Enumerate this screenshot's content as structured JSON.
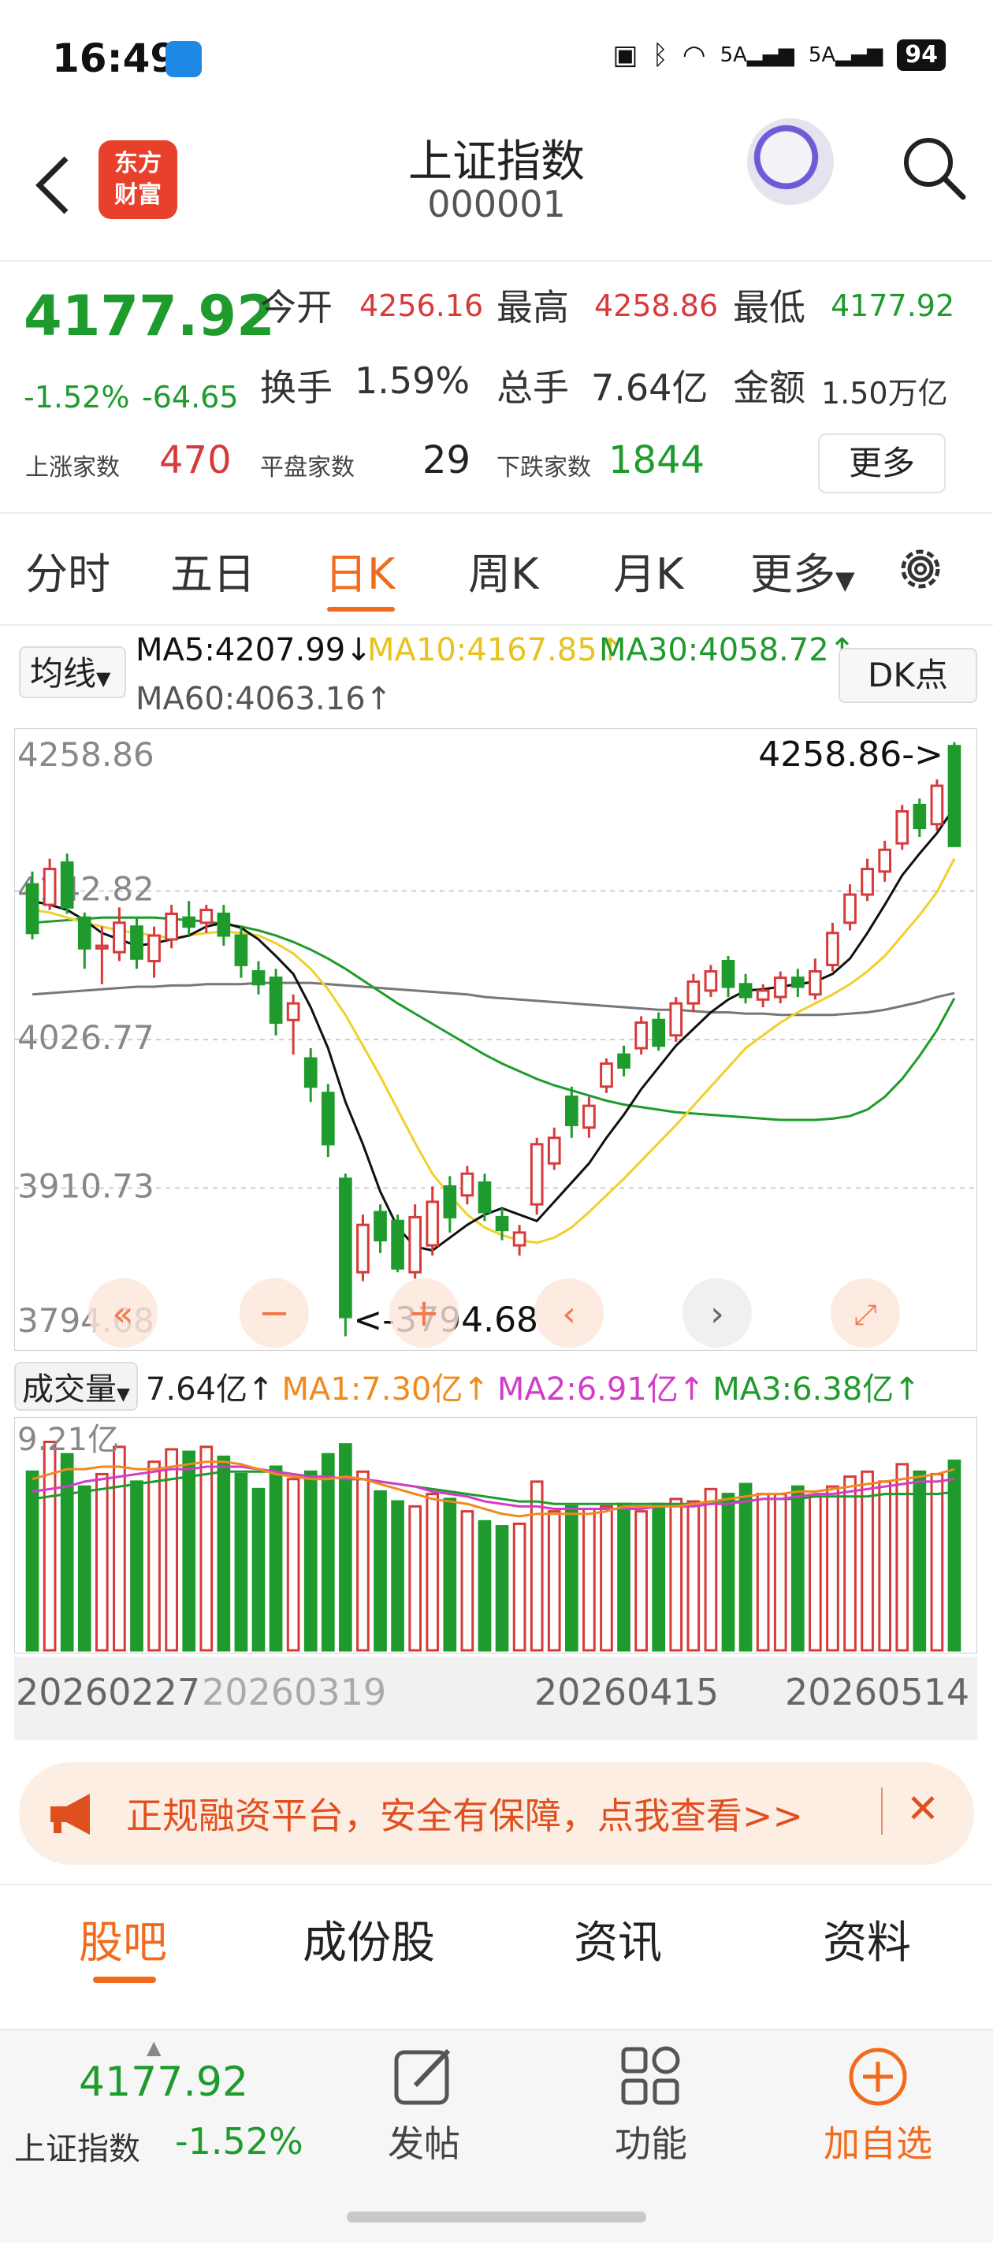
{
  "status_bar": {
    "time": "16:49",
    "battery": "94",
    "net1": "5A",
    "net2": "5A",
    "icons": [
      "nfc-icon",
      "bluetooth-icon",
      "wifi-icon",
      "signal-icon",
      "signal-icon",
      "battery-icon"
    ]
  },
  "header": {
    "logo_line1": "东方",
    "logo_line2": "财富",
    "title": "上证指数",
    "code": "000001"
  },
  "quote": {
    "price": "4177.92",
    "change_pct": "-1.52%",
    "change_abs": "-64.65",
    "open_label": "今开",
    "open": "4256.16",
    "high_label": "最高",
    "high": "4258.86",
    "low_label": "最低",
    "low": "4177.92",
    "turnover_label": "换手",
    "turnover": "1.59%",
    "volume_label": "总手",
    "volume": "7.64亿",
    "amount_label": "金额",
    "amount": "1.50万亿",
    "up_label": "上涨家数",
    "up": "470",
    "flat_label": "平盘家数",
    "flat": "29",
    "down_label": "下跌家数",
    "down": "1844",
    "more": "更多"
  },
  "tabs": [
    "分时",
    "五日",
    "日K",
    "周K",
    "月K",
    "更多"
  ],
  "active_tab": "日K",
  "ma_legend": {
    "type": "均线",
    "ma5": "MA5:4207.99",
    "ma10": "MA10:4167.85",
    "ma30": "MA30:4058.72",
    "ma60": "MA60:4063.16",
    "dk": "DK点"
  },
  "colors": {
    "up": "#d63a3a",
    "down": "#1e9b2c",
    "ma5": "#111111",
    "ma10": "#f2cf2a",
    "ma30": "#1e9b2c",
    "ma60": "#777777",
    "accent": "#f26b1d",
    "ma_mag": "#d23cc8"
  },
  "chart_data": {
    "type": "candlestick",
    "y_ticks": [
      "4258.86",
      "4142.82",
      "4026.77",
      "3910.73",
      "3794.68"
    ],
    "ylim": [
      3794.68,
      4258.86
    ],
    "max_label": "4258.86->",
    "min_label": "<-3794.68",
    "dates": [
      "20260227",
      "20260319",
      "20260415",
      "20260514"
    ],
    "candles": [
      [
        4148,
        4110,
        4158,
        4105
      ],
      [
        4132,
        4160,
        4168,
        4128
      ],
      [
        4165,
        4130,
        4172,
        4125
      ],
      [
        4122,
        4098,
        4126,
        4082
      ],
      [
        4098,
        4100,
        4115,
        4070
      ],
      [
        4095,
        4118,
        4130,
        4088
      ],
      [
        4115,
        4090,
        4122,
        4082
      ],
      [
        4088,
        4108,
        4115,
        4075
      ],
      [
        4105,
        4125,
        4132,
        4098
      ],
      [
        4122,
        4115,
        4135,
        4108
      ],
      [
        4118,
        4128,
        4132,
        4110
      ],
      [
        4125,
        4108,
        4132,
        4100
      ],
      [
        4108,
        4085,
        4115,
        4075
      ],
      [
        4080,
        4070,
        4088,
        4062
      ],
      [
        4075,
        4040,
        4082,
        4030
      ],
      [
        4042,
        4055,
        4062,
        4015
      ],
      [
        4012,
        3990,
        4020,
        3978
      ],
      [
        3985,
        3945,
        3992,
        3935
      ],
      [
        3918,
        3810,
        3922,
        3795
      ],
      [
        3845,
        3882,
        3890,
        3838
      ],
      [
        3892,
        3870,
        3898,
        3860
      ],
      [
        3885,
        3848,
        3890,
        3845
      ],
      [
        3845,
        3888,
        3898,
        3840
      ],
      [
        3866,
        3900,
        3912,
        3858
      ],
      [
        3912,
        3888,
        3920,
        3876
      ],
      [
        3905,
        3922,
        3928,
        3898
      ],
      [
        3915,
        3892,
        3922,
        3885
      ],
      [
        3888,
        3878,
        3895,
        3870
      ],
      [
        3866,
        3876,
        3882,
        3858
      ],
      [
        3898,
        3945,
        3950,
        3890
      ],
      [
        3930,
        3950,
        3958,
        3925
      ],
      [
        3982,
        3960,
        3990,
        3950
      ],
      [
        3958,
        3975,
        3982,
        3950
      ],
      [
        3990,
        4008,
        4012,
        3985
      ],
      [
        4015,
        4005,
        4022,
        3998
      ],
      [
        4020,
        4040,
        4045,
        4015
      ],
      [
        4042,
        4022,
        4048,
        4018
      ],
      [
        4030,
        4055,
        4060,
        4025
      ],
      [
        4055,
        4072,
        4078,
        4048
      ],
      [
        4065,
        4080,
        4085,
        4060
      ],
      [
        4088,
        4068,
        4092,
        4060
      ],
      [
        4070,
        4060,
        4078,
        4055
      ],
      [
        4058,
        4065,
        4070,
        4052
      ],
      [
        4060,
        4075,
        4080,
        4055
      ],
      [
        4075,
        4068,
        4082,
        4060
      ],
      [
        4062,
        4080,
        4090,
        4058
      ],
      [
        4085,
        4110,
        4118,
        4080
      ],
      [
        4118,
        4140,
        4148,
        4112
      ],
      [
        4140,
        4160,
        4168,
        4135
      ],
      [
        4158,
        4175,
        4182,
        4150
      ],
      [
        4180,
        4205,
        4210,
        4175
      ],
      [
        4210,
        4192,
        4215,
        4185
      ],
      [
        4195,
        4225,
        4230,
        4190
      ],
      [
        4256,
        4178,
        4259,
        4177
      ]
    ],
    "ma5": [
      4135,
      4132,
      4128,
      4120,
      4110,
      4105,
      4100,
      4102,
      4105,
      4108,
      4115,
      4118,
      4114,
      4105,
      4092,
      4078,
      4052,
      4020,
      3978,
      3945,
      3908,
      3880,
      3865,
      3862,
      3872,
      3882,
      3890,
      3895,
      3890,
      3885,
      3900,
      3915,
      3930,
      3950,
      3968,
      3988,
      4005,
      4022,
      4035,
      4048,
      4058,
      4065,
      4066,
      4068,
      4070,
      4072,
      4078,
      4090,
      4110,
      4132,
      4155,
      4172,
      4188,
      4208
    ],
    "ma10": [
      4128,
      4126,
      4122,
      4118,
      4115,
      4112,
      4110,
      4108,
      4106,
      4108,
      4110,
      4111,
      4110,
      4108,
      4102,
      4094,
      4082,
      4066,
      4046,
      4022,
      3998,
      3972,
      3946,
      3922,
      3905,
      3890,
      3880,
      3874,
      3870,
      3868,
      3872,
      3880,
      3892,
      3905,
      3918,
      3932,
      3946,
      3960,
      3975,
      3990,
      4005,
      4020,
      4030,
      4040,
      4048,
      4055,
      4062,
      4070,
      4080,
      4092,
      4108,
      4124,
      4142,
      4168
    ],
    "ma30": [
      4118,
      4119,
      4120,
      4121,
      4122,
      4122,
      4122,
      4122,
      4121,
      4120,
      4119,
      4117,
      4115,
      4112,
      4108,
      4103,
      4097,
      4090,
      4082,
      4073,
      4064,
      4055,
      4047,
      4039,
      4031,
      4023,
      4015,
      4008,
      4002,
      3996,
      3991,
      3987,
      3983,
      3979,
      3976,
      3974,
      3972,
      3970,
      3969,
      3968,
      3967,
      3966,
      3965,
      3964,
      3964,
      3964,
      3965,
      3967,
      3972,
      3982,
      3996,
      4014,
      4034,
      4059
    ],
    "ma60": [
      4062,
      4063,
      4064,
      4065,
      4066,
      4067,
      4068,
      4068,
      4069,
      4069,
      4070,
      4070,
      4070,
      4071,
      4071,
      4071,
      4071,
      4070,
      4069,
      4068,
      4067,
      4066,
      4065,
      4064,
      4063,
      4062,
      4060,
      4059,
      4058,
      4057,
      4056,
      4055,
      4054,
      4053,
      4052,
      4051,
      4050,
      4050,
      4049,
      4048,
      4048,
      4047,
      4047,
      4046,
      4046,
      4046,
      4046,
      4047,
      4048,
      4050,
      4053,
      4056,
      4060,
      4063
    ]
  },
  "volume": {
    "label": "成交量",
    "current": "7.64亿",
    "ma1": "MA1:7.30亿",
    "ma2": "MA2:6.91亿",
    "ma3": "MA3:6.38亿",
    "max_label": "9.21亿",
    "ylim": [
      0,
      9.21
    ],
    "values": [
      7.2,
      8.4,
      7.9,
      6.6,
      7.1,
      8.2,
      6.8,
      7.6,
      8.1,
      8.0,
      8.2,
      7.8,
      7.1,
      6.5,
      7.4,
      6.9,
      7.2,
      7.9,
      8.3,
      7.2,
      6.4,
      6.0,
      5.8,
      6.3,
      6.1,
      5.6,
      5.2,
      5.0,
      5.1,
      6.8,
      5.6,
      5.8,
      5.7,
      5.8,
      5.9,
      5.6,
      5.9,
      6.1,
      6.0,
      6.5,
      6.3,
      6.7,
      6.3,
      6.3,
      6.6,
      6.2,
      6.6,
      7.0,
      7.2,
      6.8,
      7.5,
      7.2,
      7.1,
      7.64
    ],
    "ma1_series": [
      6.9,
      7.1,
      7.3,
      7.3,
      7.4,
      7.4,
      7.3,
      7.3,
      7.4,
      7.5,
      7.6,
      7.6,
      7.5,
      7.3,
      7.1,
      7.0,
      6.9,
      6.9,
      7.0,
      6.9,
      6.7,
      6.5,
      6.3,
      6.1,
      6.0,
      5.9,
      5.7,
      5.5,
      5.4,
      5.5,
      5.5,
      5.5,
      5.5,
      5.6,
      5.8,
      5.8,
      5.8,
      5.8,
      5.9,
      6.0,
      6.1,
      6.2,
      6.3,
      6.3,
      6.4,
      6.4,
      6.5,
      6.6,
      6.7,
      6.8,
      6.9,
      7.0,
      7.1,
      7.3
    ],
    "ma2_series": [
      6.4,
      6.5,
      6.6,
      6.8,
      6.9,
      7.0,
      7.1,
      7.2,
      7.3,
      7.3,
      7.4,
      7.4,
      7.4,
      7.3,
      7.2,
      7.1,
      7.0,
      7.0,
      6.9,
      6.9,
      6.8,
      6.7,
      6.6,
      6.4,
      6.3,
      6.2,
      6.0,
      5.9,
      5.8,
      5.8,
      5.7,
      5.7,
      5.7,
      5.7,
      5.7,
      5.7,
      5.8,
      5.8,
      5.8,
      5.9,
      5.9,
      6.0,
      6.1,
      6.1,
      6.2,
      6.3,
      6.3,
      6.4,
      6.5,
      6.6,
      6.7,
      6.8,
      6.8,
      6.9
    ],
    "ma3_series": [
      6.1,
      6.2,
      6.3,
      6.4,
      6.5,
      6.6,
      6.7,
      6.8,
      6.9,
      7.0,
      7.1,
      7.2,
      7.2,
      7.2,
      7.2,
      7.1,
      7.0,
      7.0,
      6.9,
      6.9,
      6.8,
      6.7,
      6.6,
      6.5,
      6.4,
      6.3,
      6.2,
      6.1,
      6.0,
      6.0,
      5.9,
      5.9,
      5.9,
      5.9,
      5.9,
      5.9,
      5.9,
      5.9,
      5.9,
      6.0,
      6.0,
      6.0,
      6.1,
      6.1,
      6.1,
      6.2,
      6.2,
      6.2,
      6.2,
      6.3,
      6.3,
      6.3,
      6.3,
      6.38
    ]
  },
  "ad": {
    "text": "正规融资平台，安全有保障，点我查看>>"
  },
  "subtabs": [
    "股吧",
    "成份股",
    "资讯",
    "资料"
  ],
  "bottom_bar": {
    "price": "4177.92",
    "name": "上证指数",
    "pct": "-1.52%",
    "post": "发帖",
    "func": "功能",
    "add": "加自选"
  }
}
